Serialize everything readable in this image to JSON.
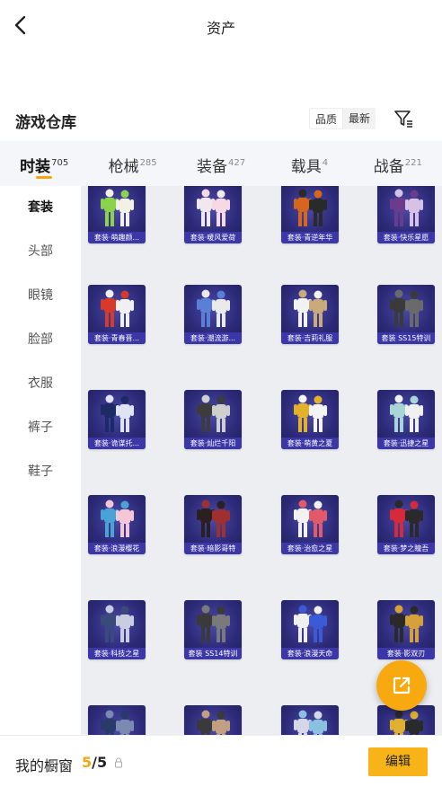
{
  "header": {
    "title": "资产"
  },
  "section": {
    "title": "游戏仓库",
    "sort_options": [
      "品质",
      "最新"
    ],
    "active_sort": "最新"
  },
  "tabs": [
    {
      "label": "时装",
      "count": "705",
      "active": true
    },
    {
      "label": "枪械",
      "count": "285",
      "active": false
    },
    {
      "label": "装备",
      "count": "427",
      "active": false
    },
    {
      "label": "载具",
      "count": "4",
      "active": false
    },
    {
      "label": "战备",
      "count": "221",
      "active": false
    }
  ],
  "sidebar": {
    "items": [
      {
        "label": "套装",
        "active": true
      },
      {
        "label": "头部",
        "active": false
      },
      {
        "label": "眼镜",
        "active": false
      },
      {
        "label": "脸部",
        "active": false
      },
      {
        "label": "衣服",
        "active": false
      },
      {
        "label": "裤子",
        "active": false
      },
      {
        "label": "鞋子",
        "active": false
      }
    ]
  },
  "items": [
    {
      "label": "套装·萌趣颜...",
      "colors": [
        "#8bd34a",
        "#f3f0e6"
      ]
    },
    {
      "label": "套装·暖风爱荷",
      "colors": [
        "#f0e8ee",
        "#f7d9e6"
      ]
    },
    {
      "label": "套装·青逆年华",
      "colors": [
        "#d6651d",
        "#2a2a2a"
      ]
    },
    {
      "label": "套装·快乐星愿",
      "colors": [
        "#6b3c8c",
        "#d7c2e6"
      ]
    },
    {
      "label": "套装·青春晋...",
      "colors": [
        "#d83a2a",
        "#f0f0f0"
      ]
    },
    {
      "label": "套装·潮流游...",
      "colors": [
        "#5a7fd6",
        "#eaeaea"
      ]
    },
    {
      "label": "套装·吉莉礼服",
      "colors": [
        "#f2f2f2",
        "#caa97a"
      ]
    },
    {
      "label": "套装 SS15特训",
      "colors": [
        "#3a3a3a",
        "#6a6a6a"
      ]
    },
    {
      "label": "套装·诡谋托...",
      "colors": [
        "#1c2a66",
        "#dfe3f3"
      ]
    },
    {
      "label": "套装·灿烂千阳",
      "colors": [
        "#3c3c3c",
        "#cfcfcf"
      ]
    },
    {
      "label": "套装·萌黄之夏",
      "colors": [
        "#e3b22a",
        "#f4f4f4"
      ]
    },
    {
      "label": "套装·迅捷之星",
      "colors": [
        "#a8d6d6",
        "#f0f0f0"
      ]
    },
    {
      "label": "套装·浪漫樱花",
      "colors": [
        "#4aa3d6",
        "#f5c6d6"
      ]
    },
    {
      "label": "套装·暗影哥特",
      "colors": [
        "#2a2020",
        "#a03030"
      ]
    },
    {
      "label": "套装·治愈之星",
      "colors": [
        "#f2f2f2",
        "#e05a6a"
      ]
    },
    {
      "label": "套装·梦之瞳吾",
      "colors": [
        "#d62a3a",
        "#2a2a2a"
      ]
    },
    {
      "label": "套装·科技之星",
      "colors": [
        "#3a4a7a",
        "#c8cde0"
      ]
    },
    {
      "label": "套装 SS14特训",
      "colors": [
        "#3a3a3a",
        "#7a7a7a"
      ]
    },
    {
      "label": "套装·浪漫天命",
      "colors": [
        "#f0f0f0",
        "#3a5ad6"
      ]
    },
    {
      "label": "套装·影双刃",
      "colors": [
        "#2a2a2a",
        "#d6a03a"
      ]
    },
    {
      "label": "",
      "colors": [
        "#2a3a6a",
        "#7a8ab0"
      ]
    },
    {
      "label": "",
      "colors": [
        "#3a3a3a",
        "#c0a080"
      ]
    },
    {
      "label": "",
      "colors": [
        "#d6d6e6",
        "#8ac0e0"
      ]
    },
    {
      "label": "",
      "colors": [
        "#e0b030",
        "#2a2a2a"
      ]
    }
  ],
  "footer": {
    "label": "我的橱窗",
    "current": "5",
    "total": "5",
    "edit_label": "编辑"
  },
  "colors": {
    "accent": "#f5a50f",
    "card_bg": "#2d2b79",
    "label_bg": "#3b37a6"
  },
  "icons": {
    "back": "chevron-left-icon",
    "filter": "filter-icon",
    "fab": "external-link-icon",
    "lock": "lock-icon"
  }
}
